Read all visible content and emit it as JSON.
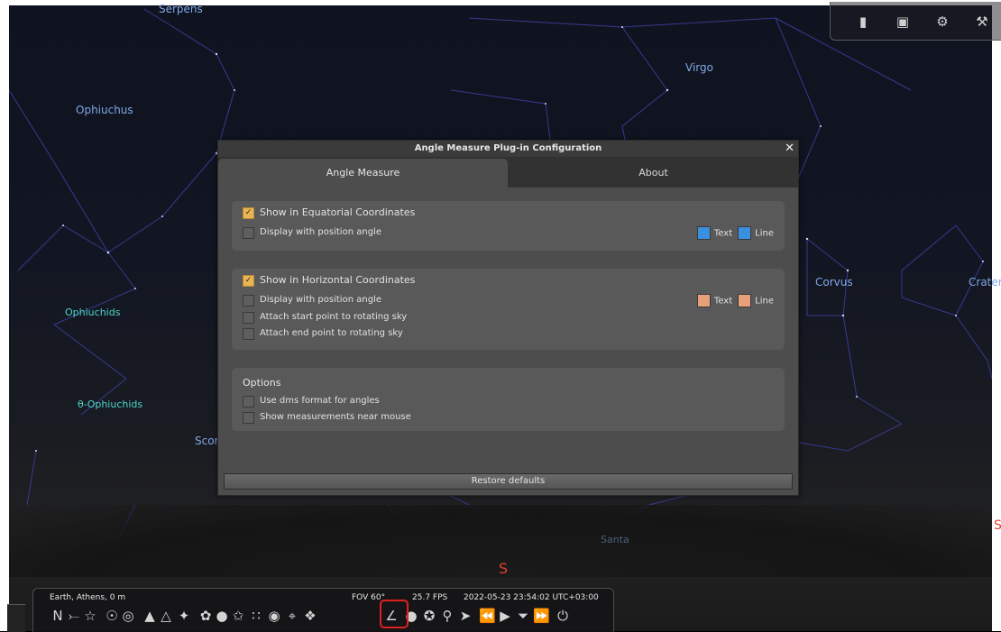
{
  "sky": {
    "constellations": [
      "Serpens",
      "Virgo",
      "Ophiuchus",
      "Corvus",
      "Crater",
      "Scorpius",
      "Santa"
    ],
    "showers": [
      "Ophiuchids",
      "θ-Ophiuchids"
    ],
    "cardinal": "S"
  },
  "top_right_icons": [
    "clock-icon",
    "screen-icon",
    "gear-wheel-icon",
    "wrench-icon"
  ],
  "dialog": {
    "title": "Angle Measure Plug-in Configuration",
    "close": "✕",
    "tabs": [
      "Angle Measure",
      "About"
    ],
    "equatorial": {
      "show_label": "Show in Equatorial Coordinates",
      "show_checked": true,
      "position_angle_label": "Display with position angle",
      "text_label": "Text",
      "line_label": "Line",
      "text_color": "#3a8fdf",
      "line_color": "#3a8fdf"
    },
    "horizontal": {
      "show_label": "Show in Horizontal Coordinates",
      "show_checked": true,
      "position_angle_label": "Display with position angle",
      "attach_start_label": "Attach start point to rotating sky",
      "attach_end_label": "Attach end point to rotating sky",
      "text_label": "Text",
      "line_label": "Line",
      "text_color": "#e8a07a",
      "line_color": "#e8a07a"
    },
    "options": {
      "title": "Options",
      "dms_label": "Use dms format for angles",
      "near_mouse_label": "Show measurements near mouse"
    },
    "restore_label": "Restore defaults"
  },
  "status_bar": {
    "location": "Earth, Athens, 0 m",
    "fov": "FOV 60°",
    "fps": "25.7 FPS",
    "datetime": "2022-05-23 23:54:02 UTC+03:00"
  }
}
